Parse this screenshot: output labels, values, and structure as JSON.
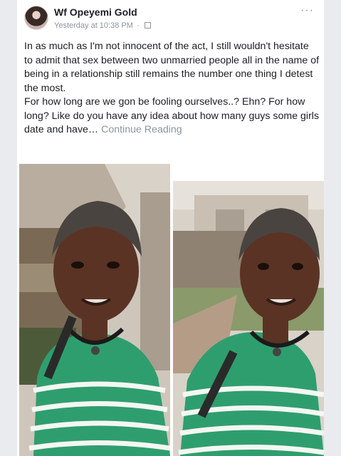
{
  "post": {
    "author": "Wf Opeyemi Gold",
    "timestamp": "Yesterday at 10:38 PM",
    "separator": "·",
    "more_label": "···",
    "paragraph1": "In as much as I'm not innocent of the act, I still wouldn't hesitate to admit that sex between two unmarried people all in the name of being in a relationship still remains the number one thing I detest the most.",
    "paragraph2": "For how long are we gon be fooling ourselves..? Ehn? For how long? Like do you have any idea about how many guys some girls date and have…",
    "continue_label": "Continue Reading"
  },
  "icons": {
    "privacy": "globe-icon",
    "menu": "more-options-icon"
  },
  "colors": {
    "name": "#1c1e21",
    "meta": "#8d949e",
    "shirt_green": "#2f9e6e",
    "shirt_stripe": "#f4f7f2",
    "skin": "#5a3324"
  }
}
